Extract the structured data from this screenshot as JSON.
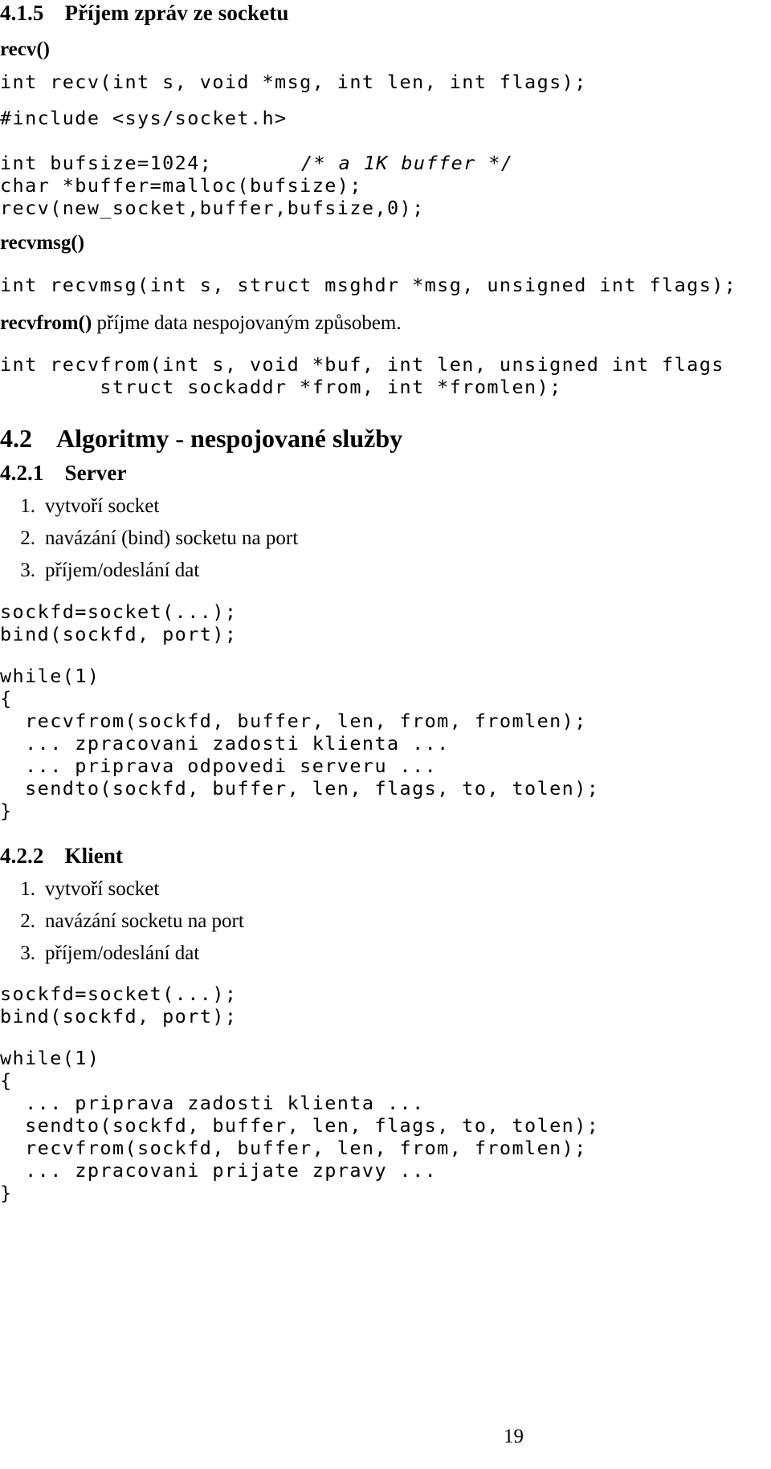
{
  "document": {
    "language": "cs",
    "page_number": "19"
  },
  "sections": {
    "s415": {
      "number": "4.1.5",
      "title": "Příjem zpráv ze socketu"
    },
    "s42": {
      "number": "4.2",
      "title": "Algoritmy - nespojované služby"
    },
    "s421": {
      "number": "4.2.1",
      "title": "Server"
    },
    "s422": {
      "number": "4.2.2",
      "title": "Klient"
    }
  },
  "recv": {
    "heading": "recv()",
    "prototype": "int recv(int s, void *msg, int len, int flags);",
    "include": "#include <sys/socket.h>",
    "example": {
      "line1_code": "int bufsize=1024;",
      "line1_comment": "/* a 1K buffer */",
      "line2": "char *buffer=malloc(bufsize);",
      "line3": "recv(new_socket,buffer,bufsize,0);"
    }
  },
  "recvmsg": {
    "heading": "recvmsg()",
    "prototype": "int recvmsg(int s, struct msghdr *msg, unsigned int flags);"
  },
  "recvfrom": {
    "label": "recvfrom()",
    "description": "příjme data nespojovaným způsobem.",
    "prototype_line1": "int recvfrom(int s, void *buf, int len, unsigned int flags",
    "prototype_line2": "        struct sockaddr *from, int *fromlen);"
  },
  "server": {
    "steps": [
      {
        "marker": "1.",
        "text": "vytvoří socket"
      },
      {
        "marker": "2.",
        "text": "navázání (bind) socketu na port"
      },
      {
        "marker": "3.",
        "text": "příjem/odeslání dat"
      }
    ],
    "code_block1": [
      "sockfd=socket(...);",
      "bind(sockfd, port);"
    ],
    "code_block2": [
      "while(1)",
      "{",
      "  recvfrom(sockfd, buffer, len, from, fromlen);",
      "  ... zpracovani zadosti klienta ...",
      "  ... priprava odpovedi serveru ...",
      "  sendto(sockfd, buffer, len, flags, to, tolen);",
      "}"
    ]
  },
  "client": {
    "steps": [
      {
        "marker": "1.",
        "text": "vytvoří socket"
      },
      {
        "marker": "2.",
        "text": "navázání socketu na port"
      },
      {
        "marker": "3.",
        "text": "příjem/odeslání dat"
      }
    ],
    "code_block1": [
      "sockfd=socket(...);",
      "bind(sockfd, port);"
    ],
    "code_block2": [
      "while(1)",
      "{",
      "  ... priprava zadosti klienta ...",
      "  sendto(sockfd, buffer, len, flags, to, tolen);",
      "  recvfrom(sockfd, buffer, len, from, fromlen);",
      "  ... zpracovani prijate zpravy ...",
      "}"
    ]
  }
}
